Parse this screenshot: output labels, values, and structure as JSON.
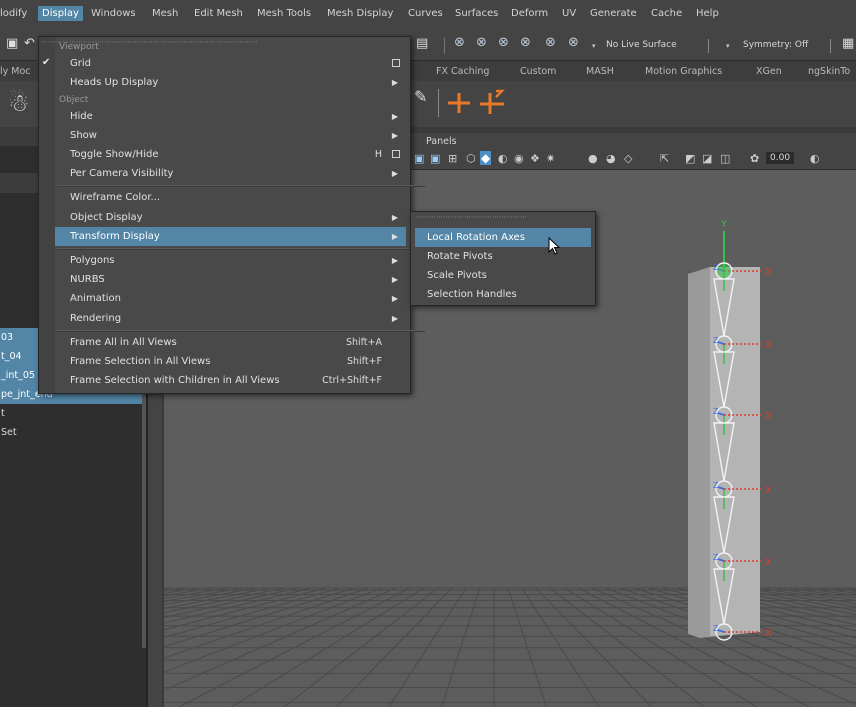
{
  "menubar": {
    "items": [
      "lodify",
      "Display",
      "Windows",
      "Mesh",
      "Edit Mesh",
      "Mesh Tools",
      "Mesh Display",
      "Curves",
      "Surfaces",
      "Deform",
      "UV",
      "Generate",
      "Cache",
      "Help"
    ],
    "active_index": 1
  },
  "toolbar": {
    "live_surface": "No Live Surface",
    "symmetry": "Symmetry: Off"
  },
  "shelf_tabs": [
    "ly Moc",
    "FX Caching",
    "Custom",
    "MASH",
    "Motion Graphics",
    "XGen",
    "ngSkinTo"
  ],
  "outliner": {
    "items": [
      {
        "label": "03",
        "selected": true
      },
      {
        "label": "t_04",
        "selected": true
      },
      {
        "label": "_int_05",
        "selected": true
      },
      {
        "label": "pe_jnt_end",
        "selected": true
      },
      {
        "label": "t",
        "selected": false
      },
      {
        "label": "Set",
        "selected": false
      }
    ]
  },
  "viewport": {
    "panels_label": "Panels",
    "value_field": "0.00"
  },
  "display_menu": {
    "sections": [
      {
        "title": "Viewport",
        "items": [
          {
            "label": "Grid",
            "checked": true,
            "option_box": true
          },
          {
            "label": "Heads Up Display",
            "submenu": true
          }
        ]
      },
      {
        "title": "Object",
        "items": [
          {
            "label": "Hide",
            "submenu": true
          },
          {
            "label": "Show",
            "submenu": true
          },
          {
            "label": "Toggle Show/Hide",
            "shortcut": "H",
            "option_box": true
          },
          {
            "label": "Per Camera Visibility",
            "submenu": true
          }
        ]
      },
      {
        "title": "",
        "items": [
          {
            "label": "Wireframe Color..."
          },
          {
            "label": "Object Display",
            "submenu": true
          },
          {
            "label": "Transform Display",
            "submenu": true,
            "highlighted": true
          }
        ]
      },
      {
        "title": "",
        "items": [
          {
            "label": "Polygons",
            "submenu": true
          },
          {
            "label": "NURBS",
            "submenu": true
          },
          {
            "label": "Animation",
            "submenu": true
          },
          {
            "label": "Rendering",
            "submenu": true
          }
        ]
      },
      {
        "title": "",
        "items": [
          {
            "label": "Frame All in All Views",
            "shortcut": "Shift+A"
          },
          {
            "label": "Frame Selection in All Views",
            "shortcut": "Shift+F"
          },
          {
            "label": "Frame Selection with Children in All Views",
            "shortcut": "Ctrl+Shift+F"
          }
        ]
      }
    ]
  },
  "transform_submenu": {
    "items": [
      "Local Rotation Axes",
      "Rotate Pivots",
      "Scale Pivots",
      "Selection Handles"
    ],
    "highlighted_index": 0
  },
  "joint_axes": {
    "y": "Y",
    "x": "X",
    "z": "Z"
  },
  "colors": {
    "accent": "#5285a6",
    "viewport_bg": "#5d5d5d",
    "grid_line": "#4a4a4a",
    "x_axis": "#e03a2c",
    "y_axis": "#36c24a",
    "z_axis": "#3a6fe0",
    "bone": "#f2f2f2",
    "column": "#a8a8a8"
  }
}
